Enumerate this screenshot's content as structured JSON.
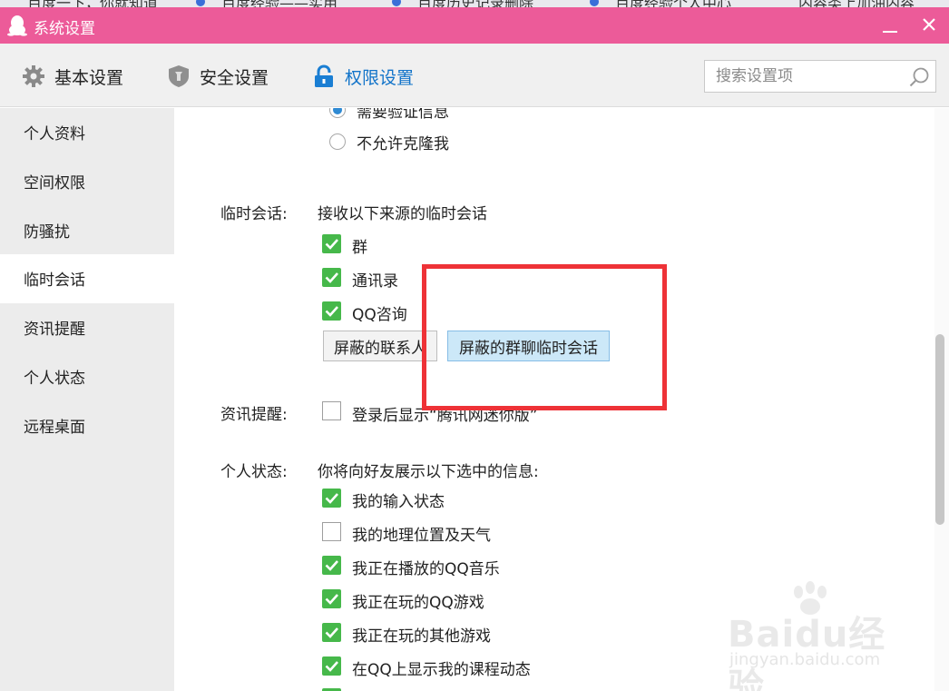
{
  "window": {
    "title": "系统设置"
  },
  "background_tabs": [
    "百度一下，你就知道",
    "百度经验——实用",
    "百度历史记录删除",
    "百度经验个人中心",
    "内容类上加油内容"
  ],
  "toolbar": {
    "tabs": [
      {
        "label": "基本设置",
        "icon": "gear-icon"
      },
      {
        "label": "安全设置",
        "icon": "shield-icon"
      },
      {
        "label": "权限设置",
        "icon": "lock-icon",
        "active": true
      }
    ],
    "search_placeholder": "搜索设置项"
  },
  "sidebar": {
    "items": [
      {
        "label": "个人资料"
      },
      {
        "label": "空间权限"
      },
      {
        "label": "防骚扰"
      },
      {
        "label": "临时会话",
        "active": true
      },
      {
        "label": "资讯提醒"
      },
      {
        "label": "个人状态"
      },
      {
        "label": "远程桌面"
      }
    ]
  },
  "content": {
    "clone_options": [
      {
        "label": "需要验证信息",
        "selected": true
      },
      {
        "label": "不允许克隆我",
        "selected": false
      }
    ],
    "temp_chat": {
      "label": "临时会话:",
      "description": "接收以下来源的临时会话",
      "options": [
        {
          "label": "群",
          "checked": true
        },
        {
          "label": "通讯录",
          "checked": true
        },
        {
          "label": "QQ咨询",
          "checked": true
        }
      ],
      "buttons": {
        "blocked_contacts": "屏蔽的联系人",
        "blocked_group_chat": "屏蔽的群聊临时会话"
      }
    },
    "news_alert": {
      "label": "资讯提醒:",
      "option": {
        "label": "登录后显示“腾讯网迷你版”",
        "checked": false
      }
    },
    "personal_status": {
      "label": "个人状态:",
      "description": "你将向好友展示以下选中的信息:",
      "options": [
        {
          "label": "我的输入状态",
          "checked": true
        },
        {
          "label": "我的地理位置及天气",
          "checked": false
        },
        {
          "label": "我正在播放的QQ音乐",
          "checked": true
        },
        {
          "label": "我正在玩的QQ游戏",
          "checked": true
        },
        {
          "label": "我正在玩的其他游戏",
          "checked": true
        },
        {
          "label": "在QQ上显示我的课程动态",
          "checked": true
        }
      ]
    }
  },
  "watermark": {
    "brand": "Baidu经验",
    "url": "jingyan.baidu.com"
  },
  "colors": {
    "titlebar": "#ec5b99",
    "accent_blue": "#1173c9",
    "checkbox_green": "#46b84a",
    "annotation_red": "#ee3237"
  }
}
